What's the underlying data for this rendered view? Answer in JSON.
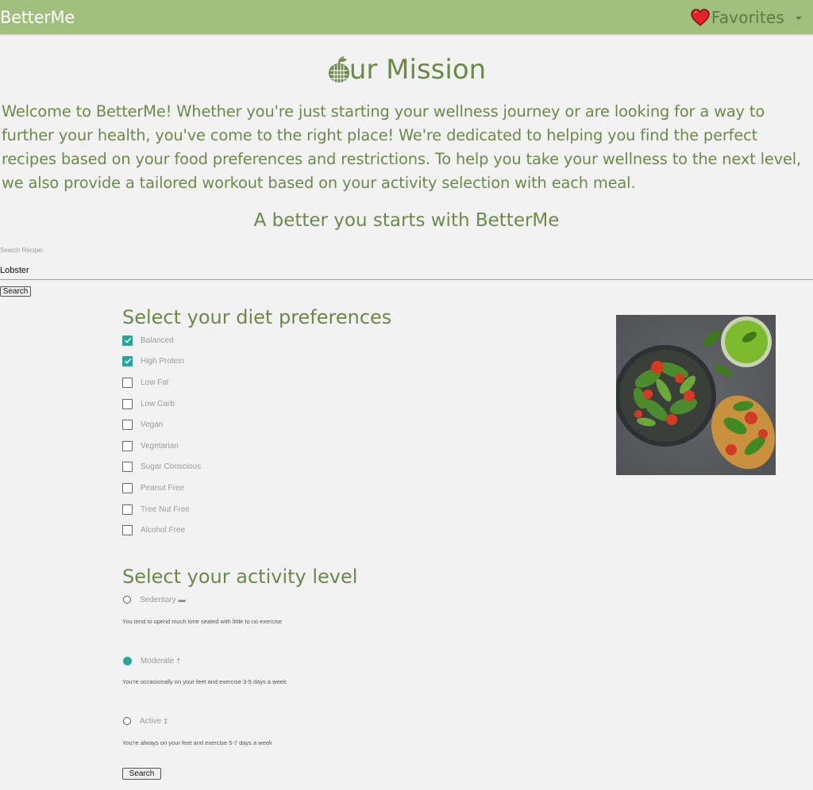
{
  "navbar": {
    "brand": "BetterMe",
    "favorites_label": "Favorites",
    "bg_color": "#a0bf7e"
  },
  "mission": {
    "title": "ur Mission",
    "intro": "Welcome to BetterMe! Whether you're just starting your wellness journey or are looking for a way to further your health, you've come to the right place! We're dedicated to helping you find the perfect recipes based on your food preferences and restrictions. To help you take your wellness to the next level, we also provide a tailored workout based on your activity selection with each meal.",
    "tagline": "A better you starts with BetterMe",
    "text_color": "#6b8a48"
  },
  "search": {
    "label": "Search Recipe:",
    "value": "Lobster",
    "button_label": "Search"
  },
  "diet": {
    "heading": "Select your diet preferences",
    "options": [
      {
        "label": "Balanced",
        "checked": true
      },
      {
        "label": "High Protein",
        "checked": true
      },
      {
        "label": "Low Fat",
        "checked": false
      },
      {
        "label": "Low Carb",
        "checked": false
      },
      {
        "label": "Vegan",
        "checked": false
      },
      {
        "label": "Vegetarian",
        "checked": false
      },
      {
        "label": "Sugar Conscious",
        "checked": false
      },
      {
        "label": "Peanut Free",
        "checked": false
      },
      {
        "label": "Tree Nut Free",
        "checked": false
      },
      {
        "label": "Alcohol Free",
        "checked": false
      }
    ],
    "accent_color": "#26a69a"
  },
  "activity": {
    "heading": "Select your activity level",
    "options": [
      {
        "label": "Sedentary",
        "icon": "couch-icon",
        "description": "You tend to spend much time seated with little to no exercise",
        "selected": false
      },
      {
        "label": "Moderate",
        "icon": "walking-icon",
        "description": "You're occasionally on your feet and exercise 3-5 days a week",
        "selected": true
      },
      {
        "label": "Active",
        "icon": "running-icon",
        "description": "You're always on your feet and exercise 5-7 days a week",
        "selected": false
      }
    ],
    "button_label": "Search"
  }
}
